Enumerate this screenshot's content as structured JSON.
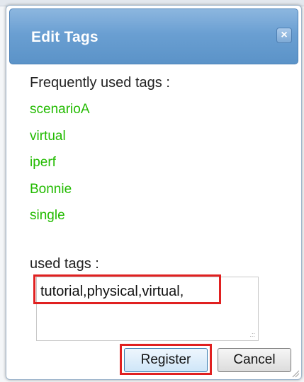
{
  "dialog": {
    "title": "Edit Tags",
    "close_glyph": "×"
  },
  "frequent": {
    "label": "Frequently used tags :",
    "tags": [
      "scenarioA",
      "virtual",
      "iperf",
      "Bonnie",
      "single"
    ]
  },
  "used": {
    "label": "used tags :",
    "value": "tutorial,physical,virtual,"
  },
  "buttons": {
    "register": "Register",
    "cancel": "Cancel"
  },
  "colors": {
    "title_bar": "#6a9fd2",
    "tag_link": "#22bb00",
    "highlight": "#e02020"
  }
}
